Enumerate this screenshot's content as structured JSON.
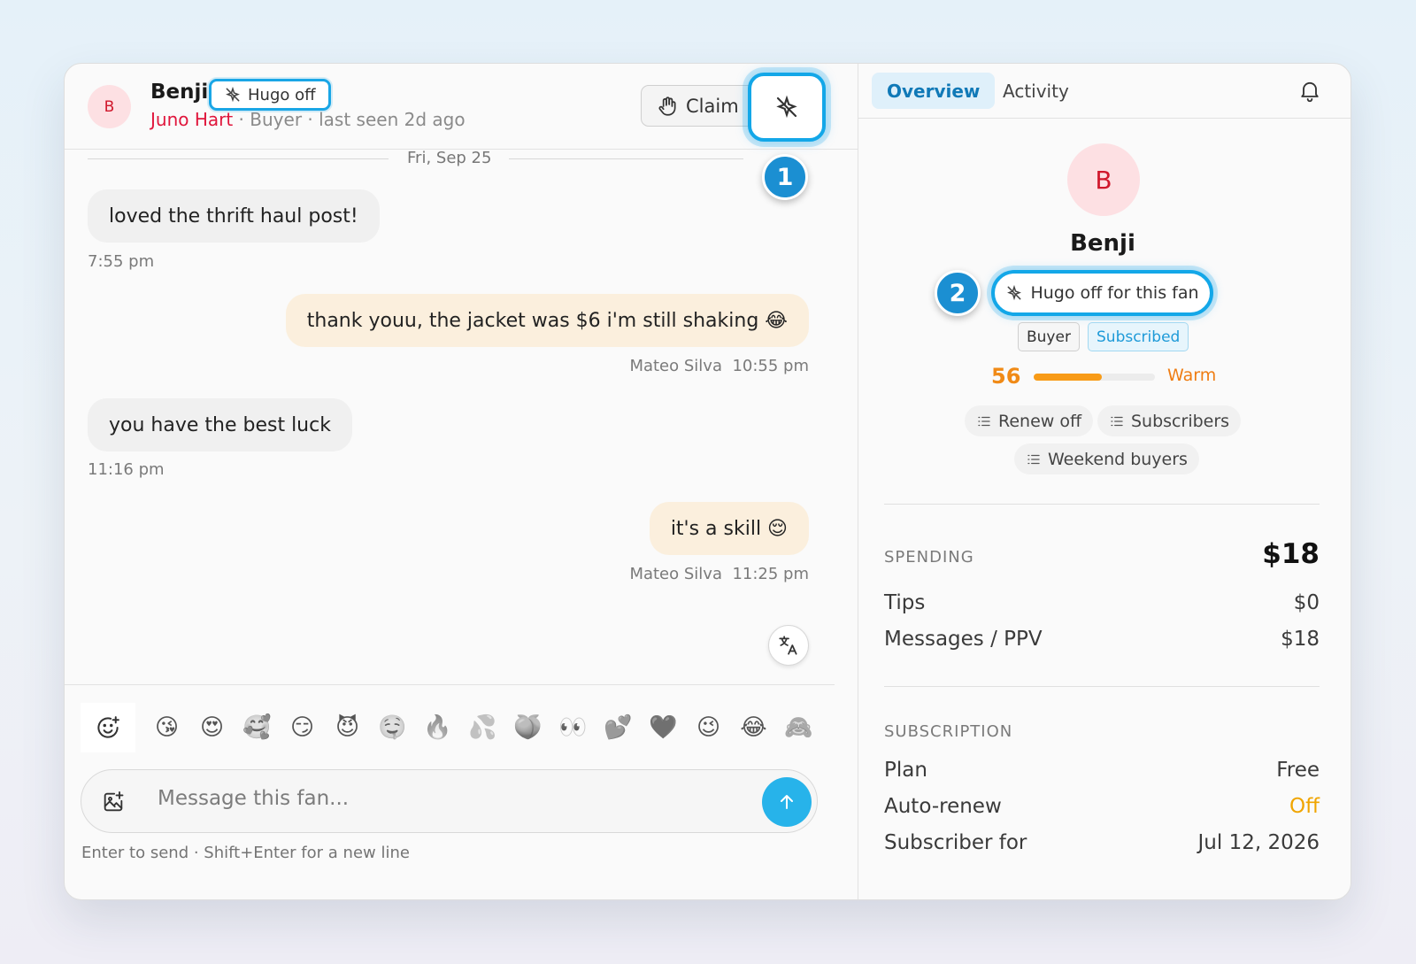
{
  "header": {
    "avatar_initial": "B",
    "fan_name": "Benji",
    "hugo_pill": "Hugo off",
    "creator": "Juno Hart",
    "sub_rest": " · Buyer · last seen 2d ago",
    "claim_label": "Claim",
    "callout_1": "1"
  },
  "thread": {
    "date": "Fri, Sep 25",
    "messages": [
      {
        "text": "loved the thrift haul post!",
        "time": "7:55 pm"
      },
      {
        "text": "thank youu, the jacket was $6 i'm still shaking 😂",
        "sender": "Mateo Silva",
        "time": "10:55 pm"
      },
      {
        "text": "you have the best luck",
        "time": "11:16 pm"
      },
      {
        "text": "it's a skill 😌",
        "sender": "Mateo Silva",
        "time": "11:25 pm"
      }
    ]
  },
  "composer": {
    "emojis": [
      "😘",
      "😍",
      "🥰",
      "😏",
      "😈",
      "🤤",
      "🔥",
      "💦",
      "🍑",
      "👀",
      "💕",
      "🖤",
      "😉",
      "😂",
      "🙈"
    ],
    "placeholder": "Message this fan...",
    "hint": "Enter to send · Shift+Enter for a new line"
  },
  "sidebar": {
    "tabs": [
      "Overview",
      "Activity"
    ],
    "avatar_initial": "B",
    "name": "Benji",
    "callout_2": "2",
    "toggle_label": "Hugo off for this fan",
    "tags": [
      "Buyer",
      "Subscribed"
    ],
    "score": "56",
    "score_fraction": 0.56,
    "score_label": "Warm",
    "lists": [
      "Renew off",
      "Subscribers",
      "Weekend buyers"
    ],
    "spending": {
      "title": "SPENDING",
      "total": "$18",
      "rows": [
        {
          "label": "Tips",
          "value": "$0"
        },
        {
          "label": "Messages / PPV",
          "value": "$18"
        }
      ]
    },
    "subscription": {
      "title": "SUBSCRIPTION",
      "rows": [
        {
          "label": "Plan",
          "value": "Free"
        },
        {
          "label": "Auto-renew",
          "value": "Off"
        },
        {
          "label": "Subscriber for",
          "value": "Jul 12, 2026"
        }
      ]
    }
  },
  "colors": {
    "accent": "#13a7e8",
    "creator_name": "#e0163c",
    "score": "#f08a16",
    "auto_renew_off": "#f0a500"
  },
  "icons": {
    "hugo_off": "sparkle-off-icon",
    "claim": "hand-icon",
    "translate": "translate-icon",
    "bell": "bell-icon",
    "emoji": "emoji-add-icon",
    "attach": "image-add-icon",
    "send": "arrow-up-icon",
    "list": "list-icon"
  }
}
